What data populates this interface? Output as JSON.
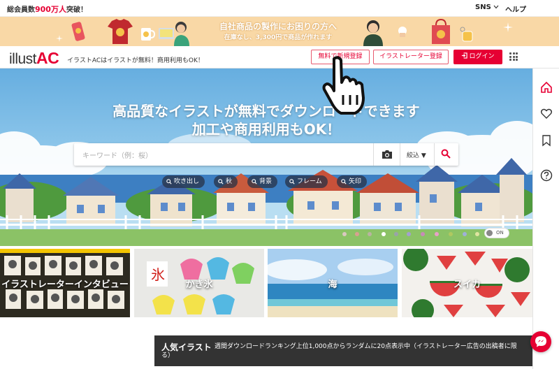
{
  "topbar": {
    "members_prefix": "総会員数",
    "members_count": "900万人",
    "members_suffix": "突破！",
    "sns_label": "SNS",
    "help_label": "ヘルプ"
  },
  "promo": {
    "line1": "自社商品の製作にお困りの方へ",
    "line2": "在庫なし、3,300円で商品が作れます"
  },
  "header": {
    "logo_text": "illust",
    "logo_accent": "AC",
    "tagline": "イラストACはイラストが無料！商用利用もOK！",
    "free_register_label": "無料で新規登録",
    "illustrator_register_label": "イラストレーター登録",
    "login_label": "ログイン"
  },
  "hero": {
    "title_line1": "高品質なイラストが無料でダウンロードできます",
    "title_line2": "加工や商用利用もOK！",
    "search_placeholder": "キーワード（例：桜）",
    "filter_label": "絞込 ▼",
    "chips": [
      {
        "label": "吹き出し"
      },
      {
        "label": "秋"
      },
      {
        "label": "背景"
      },
      {
        "label": "フレーム"
      },
      {
        "label": "矢印"
      }
    ],
    "toggle_label": "ON"
  },
  "categories": [
    {
      "label": "イラストレーターインタビュー"
    },
    {
      "label": "かき氷"
    },
    {
      "label": "海"
    },
    {
      "label": "スイカ"
    }
  ],
  "ranking": {
    "heading": "人気イラスト",
    "description": "週間ダウンロードランキング上位1,000点からランダムに20点表示中（イラストレーター広告の出稿者に限",
    "description_cont": "る）"
  },
  "colors": {
    "accent": "#e60033",
    "promo_bg": "#f9d8a6",
    "hero_sky": "#66aee0",
    "rank_bg": "#333333"
  }
}
